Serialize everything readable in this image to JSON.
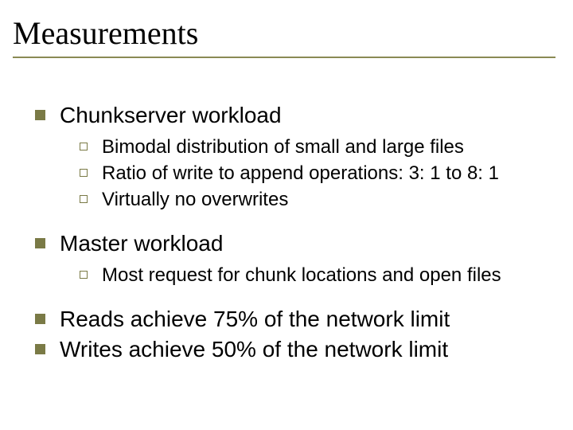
{
  "title": "Measurements",
  "items": [
    {
      "label": "Chunkserver workload",
      "children": [
        "Bimodal distribution of small and large files",
        "Ratio of write to append operations:  3: 1 to 8: 1",
        "Virtually no overwrites"
      ]
    },
    {
      "label": "Master workload",
      "children": [
        "Most request for chunk locations and open files"
      ]
    },
    {
      "label": "Reads achieve 75% of the network limit"
    },
    {
      "label": "Writes achieve 50% of the network limit"
    }
  ]
}
